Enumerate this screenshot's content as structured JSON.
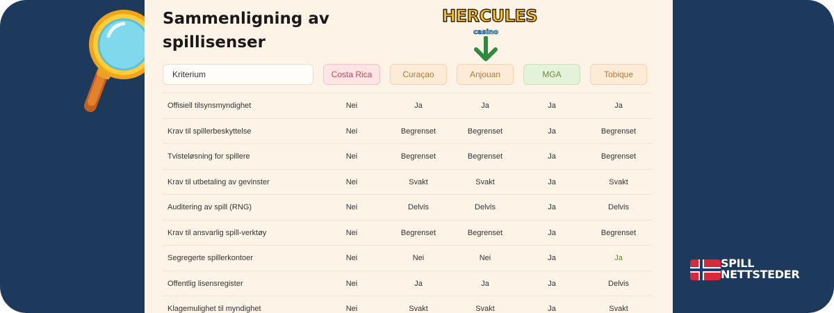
{
  "title": "Sammenligning av spillisenser",
  "logo": {
    "brand": "HERCULES",
    "sub": "casino"
  },
  "table": {
    "header_label": "Kriterium",
    "columns": [
      "Costa Rica",
      "Curaçao",
      "Anjouan",
      "MGA",
      "Tobique"
    ],
    "rows": [
      {
        "label": "Offisiell tilsynsmyndighet",
        "values": [
          "Nei",
          "Ja",
          "Ja",
          "Ja",
          "Ja"
        ]
      },
      {
        "label": "Krav til spillerbeskyttelse",
        "values": [
          "Nei",
          "Begrenset",
          "Begrenset",
          "Ja",
          "Begrenset"
        ]
      },
      {
        "label": "Tvisteløsning for spillere",
        "values": [
          "Nei",
          "Begrenset",
          "Begrenset",
          "Ja",
          "Begrenset"
        ]
      },
      {
        "label": "Krav til utbetaling av gevinster",
        "values": [
          "Nei",
          "Svakt",
          "Svakt",
          "Ja",
          "Svakt"
        ]
      },
      {
        "label": "Auditering av spill (RNG)",
        "values": [
          "Nei",
          "Delvis",
          "Delvis",
          "Ja",
          "Delvis"
        ]
      },
      {
        "label": "Krav til ansvarlig spill-verktøy",
        "values": [
          "Nei",
          "Begrenset",
          "Begrenset",
          "Ja",
          "Begrenset"
        ]
      },
      {
        "label": "Segregerte spillerkontoer",
        "values": [
          "Nei",
          "Nei",
          "Nei",
          "Ja",
          "Ja"
        ]
      },
      {
        "label": "Offentlig lisensregister",
        "values": [
          "Nei",
          "Ja",
          "Ja",
          "Ja",
          "Delvis"
        ]
      },
      {
        "label": "Klagemulighet til myndighet",
        "values": [
          "Nei",
          "Svakt",
          "Svakt",
          "Ja",
          "Svakt"
        ]
      }
    ]
  },
  "footer_brand": {
    "line1": "SPILL",
    "line2": "NETTSTEDER"
  },
  "colors": {
    "background": "#1d3a5c",
    "panel": "#fdf3e6",
    "arrow": "#2e8b3e",
    "costa_rica": "#c9455a",
    "mga": "#6a8f3c",
    "neutral_header": "#b07a3a"
  }
}
